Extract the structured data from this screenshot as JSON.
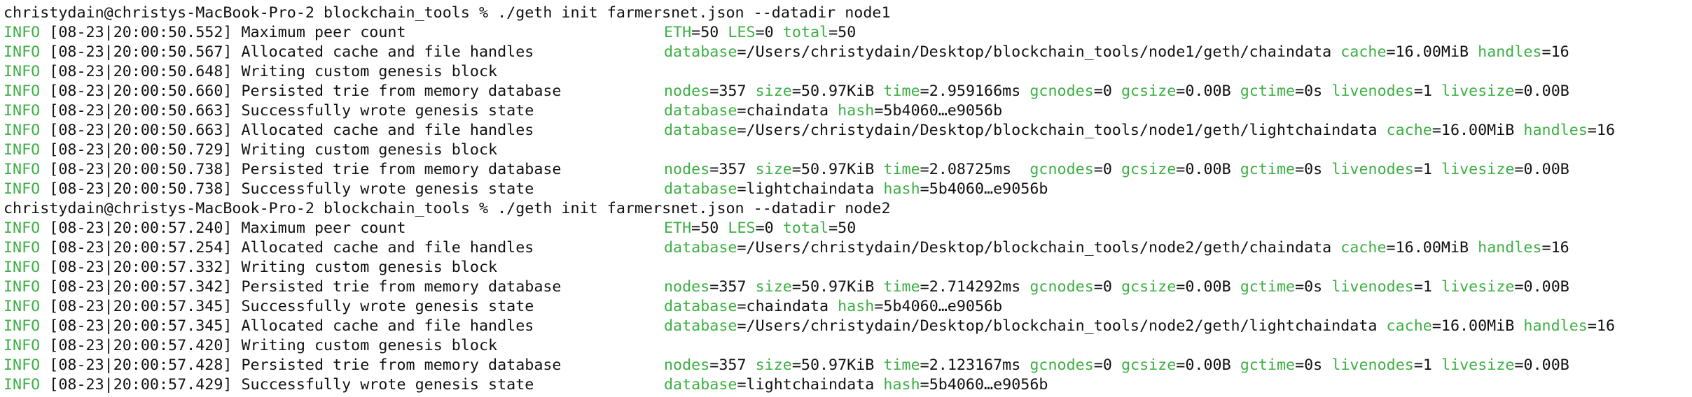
{
  "terminal": {
    "lines": [
      {
        "kind": "prompt",
        "text": "christydain@christys-MacBook-Pro-2 blockchain_tools % ./geth init farmersnet.json --datadir node1"
      },
      {
        "kind": "log",
        "level": "INFO",
        "time": "[08-23|20:00:50.552]",
        "msg": "Maximum peer count",
        "fields": [
          {
            "k": "ETH",
            "v": "50"
          },
          {
            "k": "LES",
            "v": "0"
          },
          {
            "k": "total",
            "v": "50"
          }
        ]
      },
      {
        "kind": "log",
        "level": "INFO",
        "time": "[08-23|20:00:50.567]",
        "msg": "Allocated cache and file handles",
        "fields": [
          {
            "k": "database",
            "v": "/Users/christydain/Desktop/blockchain_tools/node1/geth/chaindata"
          },
          {
            "k": "cache",
            "v": "16.00MiB"
          },
          {
            "k": "handles",
            "v": "16"
          }
        ]
      },
      {
        "kind": "log",
        "level": "INFO",
        "time": "[08-23|20:00:50.648]",
        "msg": "Writing custom genesis block",
        "fields": []
      },
      {
        "kind": "log",
        "level": "INFO",
        "time": "[08-23|20:00:50.660]",
        "msg": "Persisted trie from memory database",
        "fields": [
          {
            "k": "nodes",
            "v": "357"
          },
          {
            "k": "size",
            "v": "50.97KiB"
          },
          {
            "k": "time",
            "v": "2.959166ms"
          },
          {
            "k": "gcnodes",
            "v": "0"
          },
          {
            "k": "gcsize",
            "v": "0.00B"
          },
          {
            "k": "gctime",
            "v": "0s"
          },
          {
            "k": "livenodes",
            "v": "1"
          },
          {
            "k": "livesize",
            "v": "0.00B"
          }
        ]
      },
      {
        "kind": "log",
        "level": "INFO",
        "time": "[08-23|20:00:50.663]",
        "msg": "Successfully wrote genesis state",
        "fields": [
          {
            "k": "database",
            "v": "chaindata"
          },
          {
            "k": "hash",
            "v": "5b4060…e9056b"
          }
        ]
      },
      {
        "kind": "log",
        "level": "INFO",
        "time": "[08-23|20:00:50.663]",
        "msg": "Allocated cache and file handles",
        "fields": [
          {
            "k": "database",
            "v": "/Users/christydain/Desktop/blockchain_tools/node1/geth/lightchaindata"
          },
          {
            "k": "cache",
            "v": "16.00MiB"
          },
          {
            "k": "handles",
            "v": "16"
          }
        ]
      },
      {
        "kind": "log",
        "level": "INFO",
        "time": "[08-23|20:00:50.729]",
        "msg": "Writing custom genesis block",
        "fields": []
      },
      {
        "kind": "log",
        "level": "INFO",
        "time": "[08-23|20:00:50.738]",
        "msg": "Persisted trie from memory database",
        "fields": [
          {
            "k": "nodes",
            "v": "357"
          },
          {
            "k": "size",
            "v": "50.97KiB"
          },
          {
            "k": "time",
            "v": "2.08725ms "
          },
          {
            "k": "gcnodes",
            "v": "0"
          },
          {
            "k": "gcsize",
            "v": "0.00B"
          },
          {
            "k": "gctime",
            "v": "0s"
          },
          {
            "k": "livenodes",
            "v": "1"
          },
          {
            "k": "livesize",
            "v": "0.00B"
          }
        ]
      },
      {
        "kind": "log",
        "level": "INFO",
        "time": "[08-23|20:00:50.738]",
        "msg": "Successfully wrote genesis state",
        "fields": [
          {
            "k": "database",
            "v": "lightchaindata"
          },
          {
            "k": "hash",
            "v": "5b4060…e9056b"
          }
        ]
      },
      {
        "kind": "prompt",
        "text": "christydain@christys-MacBook-Pro-2 blockchain_tools % ./geth init farmersnet.json --datadir node2"
      },
      {
        "kind": "log",
        "level": "INFO",
        "time": "[08-23|20:00:57.240]",
        "msg": "Maximum peer count",
        "fields": [
          {
            "k": "ETH",
            "v": "50"
          },
          {
            "k": "LES",
            "v": "0"
          },
          {
            "k": "total",
            "v": "50"
          }
        ]
      },
      {
        "kind": "log",
        "level": "INFO",
        "time": "[08-23|20:00:57.254]",
        "msg": "Allocated cache and file handles",
        "fields": [
          {
            "k": "database",
            "v": "/Users/christydain/Desktop/blockchain_tools/node2/geth/chaindata"
          },
          {
            "k": "cache",
            "v": "16.00MiB"
          },
          {
            "k": "handles",
            "v": "16"
          }
        ]
      },
      {
        "kind": "log",
        "level": "INFO",
        "time": "[08-23|20:00:57.332]",
        "msg": "Writing custom genesis block",
        "fields": []
      },
      {
        "kind": "log",
        "level": "INFO",
        "time": "[08-23|20:00:57.342]",
        "msg": "Persisted trie from memory database",
        "fields": [
          {
            "k": "nodes",
            "v": "357"
          },
          {
            "k": "size",
            "v": "50.97KiB"
          },
          {
            "k": "time",
            "v": "2.714292ms"
          },
          {
            "k": "gcnodes",
            "v": "0"
          },
          {
            "k": "gcsize",
            "v": "0.00B"
          },
          {
            "k": "gctime",
            "v": "0s"
          },
          {
            "k": "livenodes",
            "v": "1"
          },
          {
            "k": "livesize",
            "v": "0.00B"
          }
        ]
      },
      {
        "kind": "log",
        "level": "INFO",
        "time": "[08-23|20:00:57.345]",
        "msg": "Successfully wrote genesis state",
        "fields": [
          {
            "k": "database",
            "v": "chaindata"
          },
          {
            "k": "hash",
            "v": "5b4060…e9056b"
          }
        ]
      },
      {
        "kind": "log",
        "level": "INFO",
        "time": "[08-23|20:00:57.345]",
        "msg": "Allocated cache and file handles",
        "fields": [
          {
            "k": "database",
            "v": "/Users/christydain/Desktop/blockchain_tools/node2/geth/lightchaindata"
          },
          {
            "k": "cache",
            "v": "16.00MiB"
          },
          {
            "k": "handles",
            "v": "16"
          }
        ]
      },
      {
        "kind": "log",
        "level": "INFO",
        "time": "[08-23|20:00:57.420]",
        "msg": "Writing custom genesis block",
        "fields": []
      },
      {
        "kind": "log",
        "level": "INFO",
        "time": "[08-23|20:00:57.428]",
        "msg": "Persisted trie from memory database",
        "fields": [
          {
            "k": "nodes",
            "v": "357"
          },
          {
            "k": "size",
            "v": "50.97KiB"
          },
          {
            "k": "time",
            "v": "2.123167ms"
          },
          {
            "k": "gcnodes",
            "v": "0"
          },
          {
            "k": "gcsize",
            "v": "0.00B"
          },
          {
            "k": "gctime",
            "v": "0s"
          },
          {
            "k": "livenodes",
            "v": "1"
          },
          {
            "k": "livesize",
            "v": "0.00B"
          }
        ]
      },
      {
        "kind": "log",
        "level": "INFO",
        "time": "[08-23|20:00:57.429]",
        "msg": "Successfully wrote genesis state",
        "fields": [
          {
            "k": "database",
            "v": "lightchaindata"
          },
          {
            "k": "hash",
            "v": "5b4060…e9056b"
          }
        ]
      }
    ]
  },
  "colors": {
    "background": "#ffffff",
    "text": "#111111",
    "accent_green": "#3cb043"
  }
}
